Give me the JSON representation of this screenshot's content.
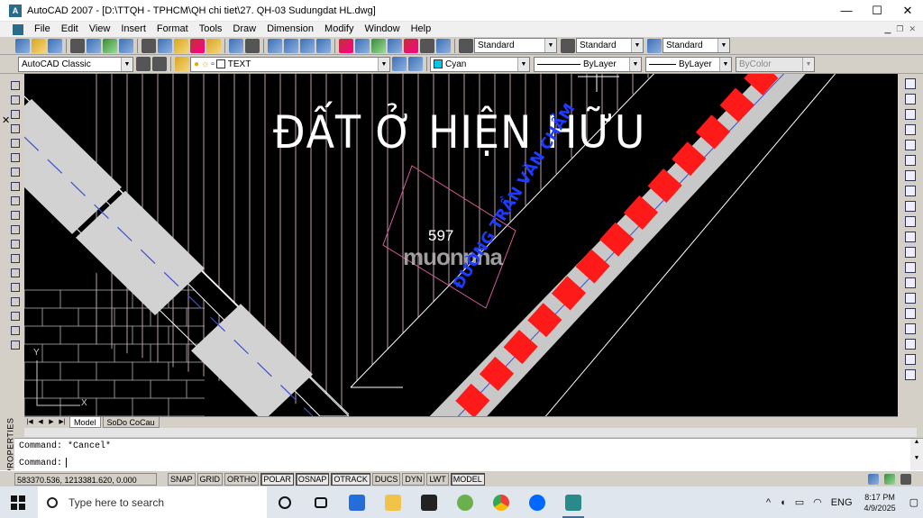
{
  "window": {
    "app_icon": "A",
    "title": "AutoCAD 2007 - [D:\\TTQH - TPHCM\\QH chi tiet\\27. QH-03 Sudungdat HL.dwg]",
    "min": "—",
    "max": "☐",
    "close": "✕"
  },
  "menu": {
    "items": [
      "File",
      "Edit",
      "View",
      "Insert",
      "Format",
      "Tools",
      "Draw",
      "Dimension",
      "Modify",
      "Window",
      "Help"
    ]
  },
  "toolbar1": {
    "text_style": "Standard",
    "dim_style": "Standard",
    "table_style": "Standard",
    "dropdown_arrow": "▼"
  },
  "toolbar2": {
    "workspace": "AutoCAD Classic",
    "layer": "TEXT",
    "color": "Cyan",
    "color_hex": "#00c8e6",
    "linetype": "ByLayer",
    "lineweight": "ByLayer",
    "plotstyle": "ByColor",
    "dropdown_arrow": "▼"
  },
  "drawing": {
    "zone_label": "ĐẤT Ở HIỆN HỮU",
    "road_label": "ĐƯỜNG TRẦN VĂN CHẨM",
    "parcel_number": "597",
    "watermark": "muonnha",
    "ucs_x": "X",
    "ucs_y": "Y",
    "colors": {
      "background": "#000000",
      "road_fill": "#c8c8c8",
      "median_red": "#ff1a1a",
      "hatch": "#e8c8d0",
      "road_label": "#1e3cff"
    }
  },
  "layout_tabs": {
    "nav": [
      "|◀",
      "◀",
      "▶",
      "▶|"
    ],
    "tabs": [
      "Model",
      "SoDo CoCau"
    ]
  },
  "command": {
    "line1": "Command: *Cancel*",
    "line2": "Command:"
  },
  "left_panel": {
    "properties_label": "PROPERTIES",
    "close": "✕"
  },
  "status": {
    "coordinates": "583370.536, 1213381.620, 0.000",
    "toggles": [
      "SNAP",
      "GRID",
      "ORTHO",
      "POLAR",
      "OSNAP",
      "OTRACK",
      "DUCS",
      "DYN",
      "LWT",
      "MODEL"
    ]
  },
  "taskbar": {
    "search_placeholder": "Type here to search",
    "language": "ENG",
    "time": "8:17 PM",
    "date": "4/9/2025",
    "tray_chevron": "^"
  }
}
